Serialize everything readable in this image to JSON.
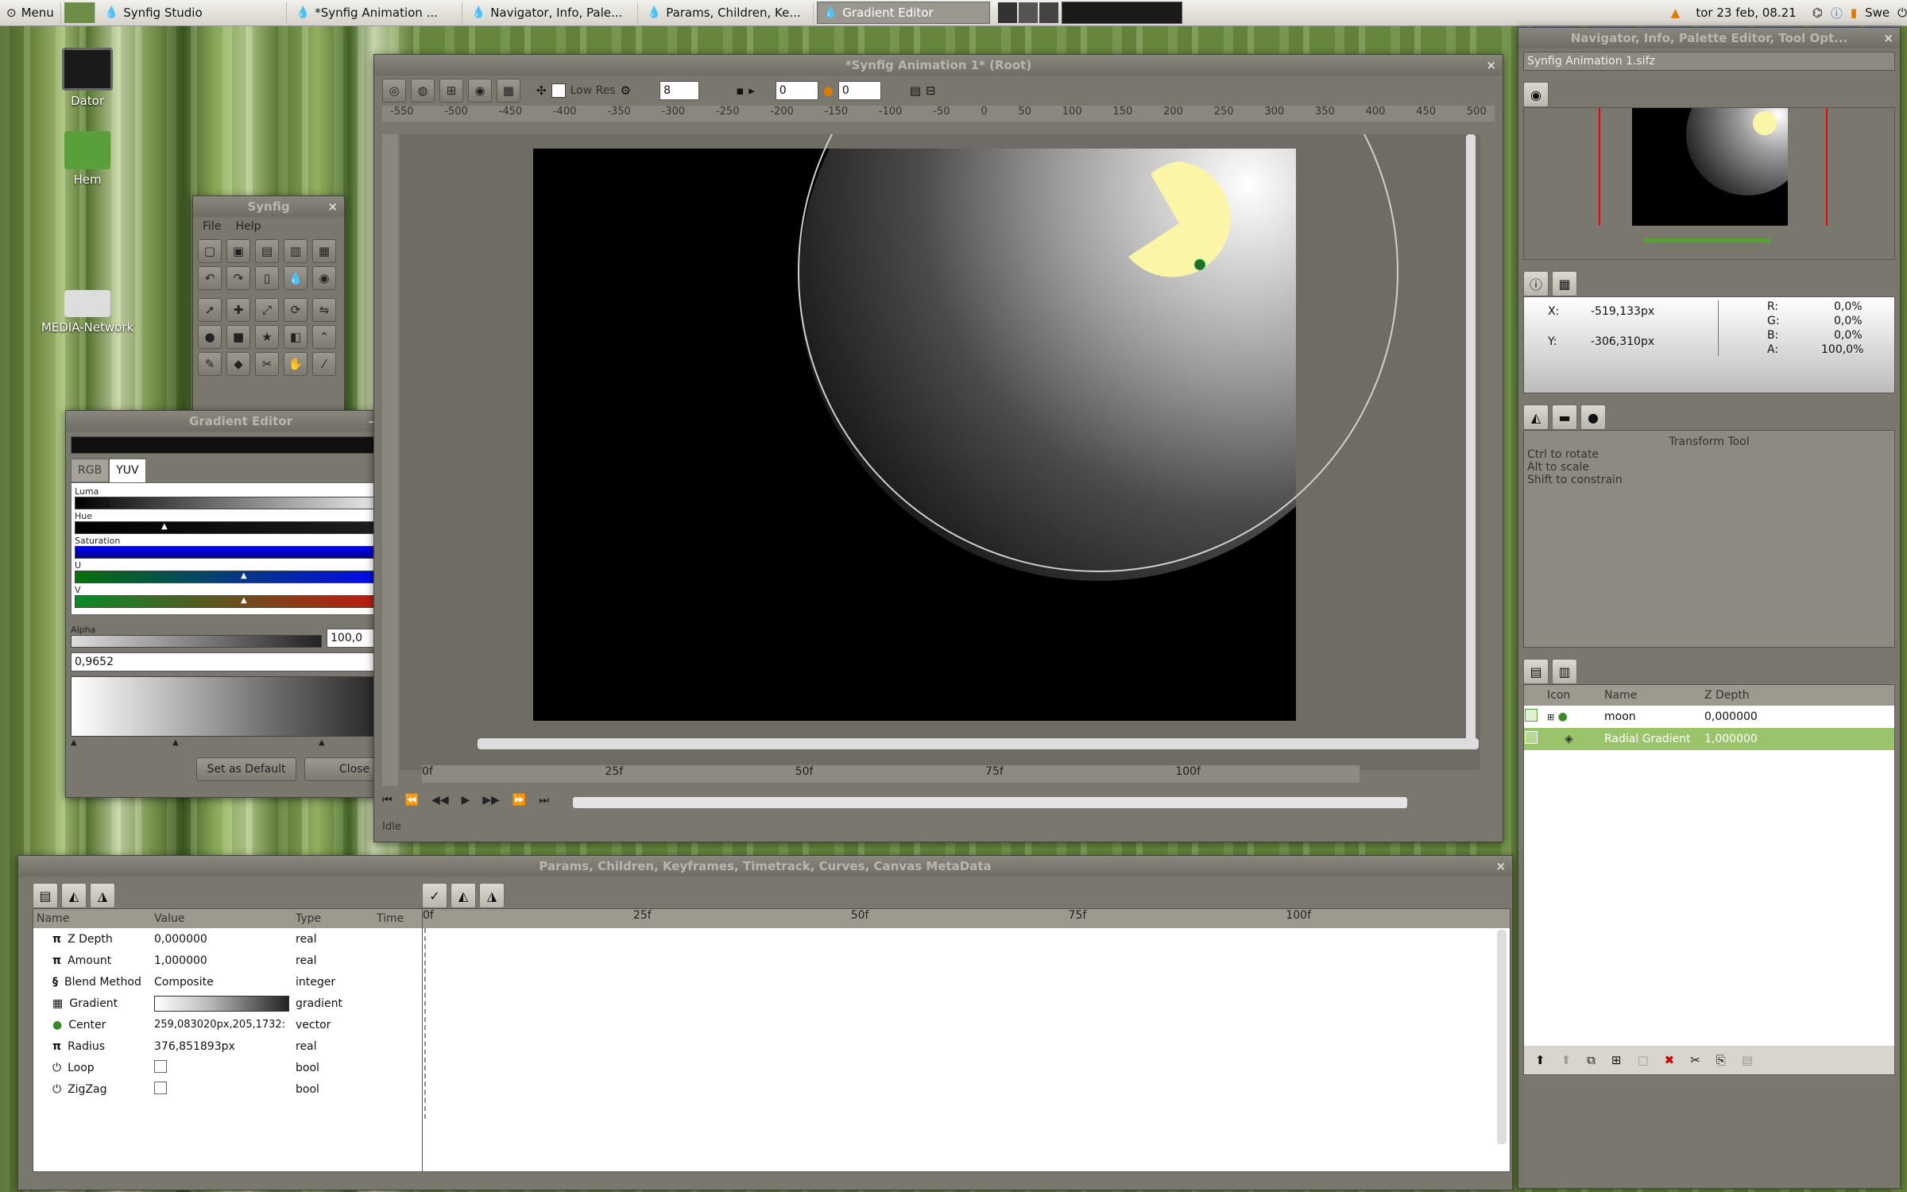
{
  "taskbar": {
    "menu_label": "Menu",
    "items": [
      {
        "label": "Synfig Studio"
      },
      {
        "label": "*Synfig Animation ..."
      },
      {
        "label": "Navigator, Info, Pale..."
      },
      {
        "label": "Params, Children, Ke..."
      },
      {
        "label": "Gradient Editor"
      }
    ],
    "clock": "tor 23 feb, 08.21",
    "keyboard": "Swe"
  },
  "desktop": {
    "icons": [
      {
        "label": "Dator"
      },
      {
        "label": "Hem"
      },
      {
        "label": "MEDIA-Network"
      }
    ]
  },
  "toolbox": {
    "title": "Synfig",
    "menu": [
      "File",
      "Help"
    ]
  },
  "gradient_editor": {
    "title": "Gradient Editor",
    "tabs": [
      "RGB",
      "YUV"
    ],
    "active_tab": "YUV",
    "sliders": [
      "Luma",
      "Hue",
      "Saturation",
      "U",
      "V"
    ],
    "alpha_label": "Alpha",
    "alpha_value": "100,0",
    "position_value": "0,9652",
    "set_default_label": "Set as Default",
    "close_label": "Close"
  },
  "canvas_window": {
    "title": "*Synfig Animation 1* (Root)",
    "low_res_label": "Low Res",
    "field1": "8",
    "field2": "0",
    "field3": "0",
    "ruler_marks": [
      "-550",
      "-500",
      "-450",
      "-400",
      "-350",
      "-300",
      "-250",
      "-200",
      "-150",
      "-100",
      "-50",
      "0",
      "50",
      "100",
      "150",
      "200",
      "250",
      "300",
      "350",
      "400",
      "450",
      "500"
    ],
    "time_marks": [
      "0f",
      "25f",
      "50f",
      "75f",
      "100f"
    ],
    "status": "Idle"
  },
  "right_panel": {
    "title": "Navigator, Info, Palette Editor, Tool Opt...",
    "file_select": "Synfig Animation 1.sifz",
    "info": {
      "x_label": "X:",
      "x_value": "-519,133px",
      "y_label": "Y:",
      "y_value": "-306,310px",
      "r_label": "R:",
      "r_value": "0,0%",
      "g_label": "G:",
      "g_value": "0,0%",
      "b_label": "B:",
      "b_value": "0,0%",
      "a_label": "A:",
      "a_value": "100,0%"
    },
    "tool_options": {
      "title": "Transform Tool",
      "lines": [
        "Ctrl to rotate",
        "Alt to scale",
        "Shift to constrain"
      ]
    },
    "layers": {
      "columns": [
        "Icon",
        "Name",
        "Z Depth"
      ],
      "rows": [
        {
          "name": "moon",
          "z": "0,000000",
          "selected": false
        },
        {
          "name": "Radial Gradient",
          "z": "1,000000",
          "selected": true
        }
      ]
    }
  },
  "params_window": {
    "title": "Params, Children, Keyframes, Timetrack, Curves, Canvas MetaData",
    "columns": [
      "Name",
      "Value",
      "Type",
      "Time"
    ],
    "rows": [
      {
        "icon": "π",
        "name": "Z Depth",
        "value": "0,000000",
        "type": "real"
      },
      {
        "icon": "π",
        "name": "Amount",
        "value": "1,000000",
        "type": "real"
      },
      {
        "icon": "§",
        "name": "Blend Method",
        "value": "Composite",
        "type": "integer"
      },
      {
        "icon": "▦",
        "name": "Gradient",
        "value": "",
        "type": "gradient"
      },
      {
        "icon": "●",
        "name": "Center",
        "value": "259,083020px,205,1732:",
        "type": "vector"
      },
      {
        "icon": "π",
        "name": "Radius",
        "value": "376,851893px",
        "type": "real"
      },
      {
        "icon": "⏻",
        "name": "Loop",
        "value": "",
        "type": "bool"
      },
      {
        "icon": "⏻",
        "name": "ZigZag",
        "value": "",
        "type": "bool"
      }
    ],
    "timetrack_marks": [
      "0f",
      "25f",
      "50f",
      "75f",
      "100f"
    ]
  },
  "colors": {
    "selection": "#9bc36b",
    "panel": "#7a776f",
    "moon": "#fbf5a8"
  }
}
